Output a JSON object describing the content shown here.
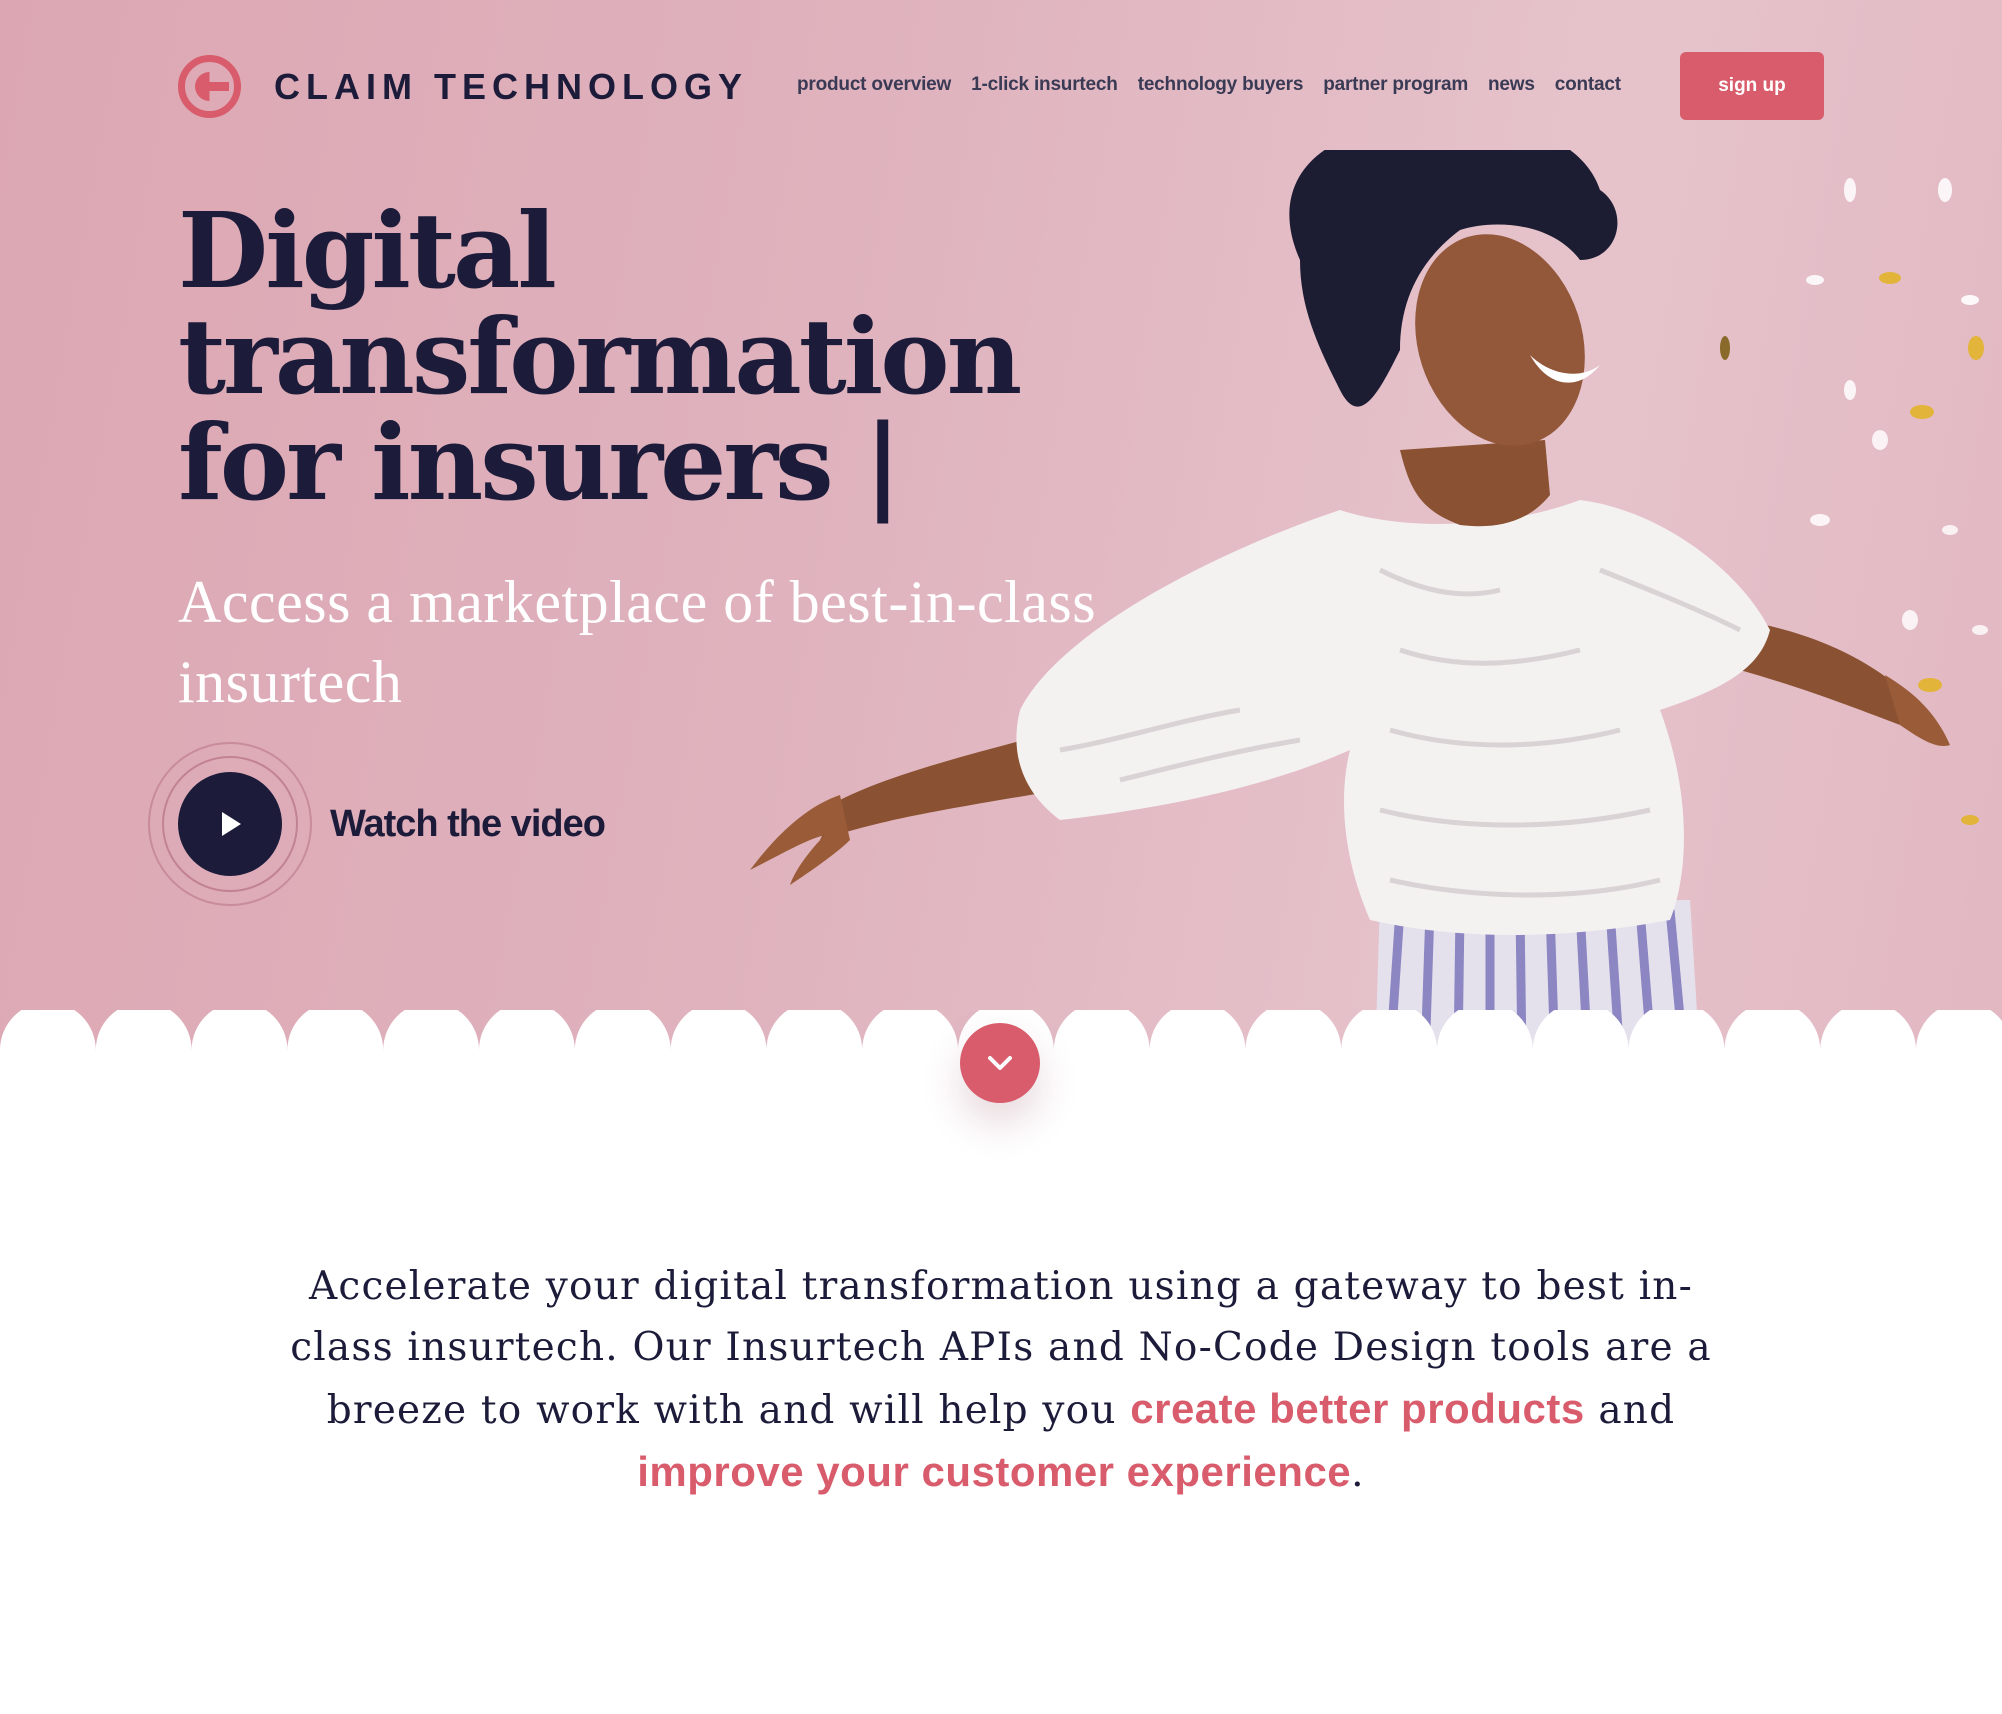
{
  "header": {
    "brand": "CLAIM TECHNOLOGY",
    "nav": [
      "product overview",
      "1-click insurtech",
      "technology buyers",
      "partner program",
      "news",
      "contact"
    ],
    "signup_label": "sign up"
  },
  "hero": {
    "headline": {
      "line1": "Digital",
      "line2": "transformation",
      "line3": "for insurers |"
    },
    "subline": {
      "line1": "Access a marketplace of best-in-class",
      "line2": "insurtech"
    },
    "watch_label": "Watch the video"
  },
  "intro": {
    "part1": "Accelerate your digital transformation using a gateway to best in-class insurtech. Our Insurtech APIs and No-Code Design tools are a breeze to work with and will help you ",
    "highlight1": "create better products",
    "part2": " and ",
    "highlight2": "improve your customer experience",
    "part3": "."
  },
  "icons": {
    "logo": "claim-technology-logo-icon",
    "play": "play-icon",
    "down": "chevron-down-icon"
  },
  "colors": {
    "accent": "#d95c6c",
    "navy": "#1c1c3a",
    "hero_pink": "#dfb2bd",
    "white": "#ffffff"
  }
}
